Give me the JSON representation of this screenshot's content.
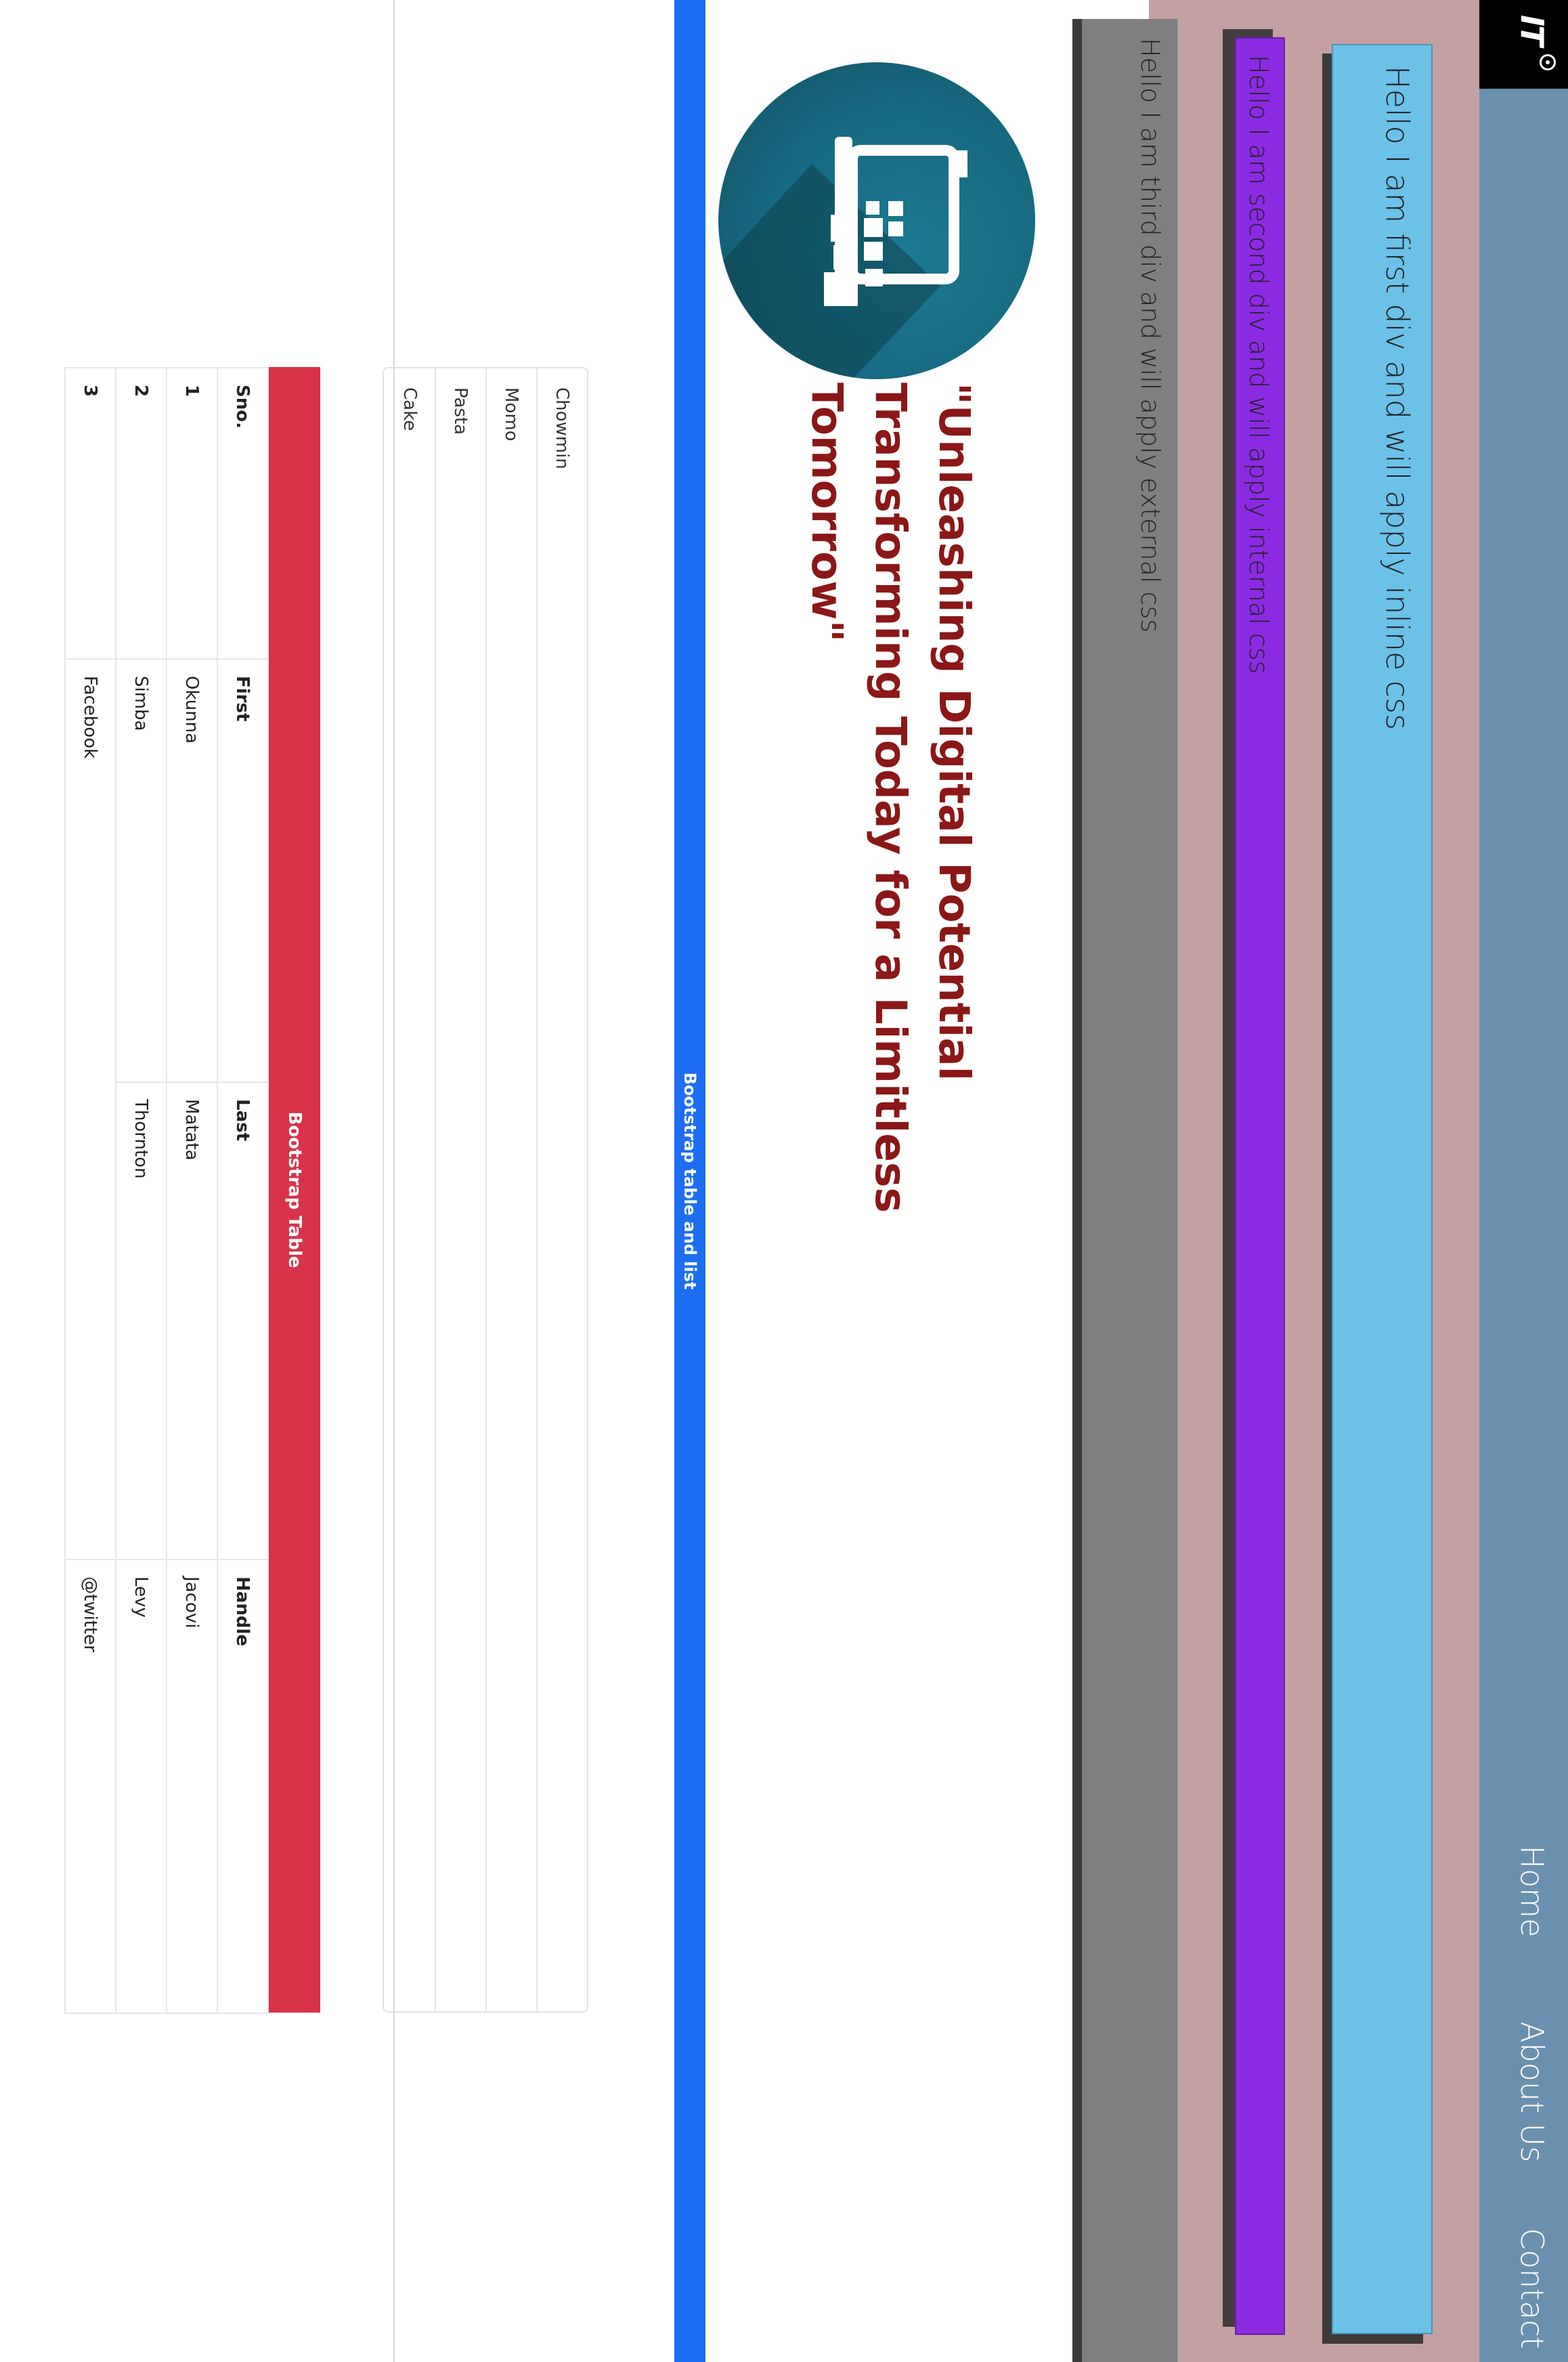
{
  "navbar": {
    "logo_text": "IT",
    "links": [
      "Home",
      "About Us",
      "Contact"
    ]
  },
  "divs": {
    "first": "Hello I am first div and will apply inline css",
    "second": "Hello I am second div and will apply internal css",
    "third": "Hello I am third div and will apply external css"
  },
  "hero": {
    "tagline_line1": "\"Unleashing Digital Potential",
    "tagline_line2": "Transforming Today for a Limitless Tomorrow\""
  },
  "section_heading": "Bootstrap table and list",
  "list": {
    "items": [
      "Chowmin",
      "Momo",
      "Pasta",
      "Cake"
    ]
  },
  "table": {
    "caption": "Bootstrap Table",
    "headers": [
      "Sno.",
      "First",
      "Last",
      "Handle"
    ],
    "rows": [
      [
        "1",
        "Okunna",
        "Matata",
        "Jacovi"
      ],
      [
        "2",
        "Simba",
        "Thornton",
        "Levy"
      ],
      [
        "3",
        "Facebook",
        "",
        "@twitter"
      ]
    ]
  },
  "colors": {
    "navbar": "#6a90b0",
    "band": "#c4a0a3",
    "first_div": "#6cc1e7",
    "second_div": "#8a2be2",
    "third_div": "#7f7f7f",
    "tagline": "#8b1717",
    "heading_bar": "#1d6ef3",
    "table_caption": "#d7334a"
  }
}
